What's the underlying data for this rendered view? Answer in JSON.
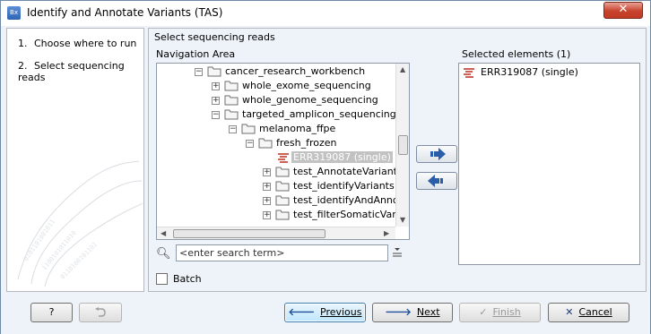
{
  "window": {
    "title": "Identify and Annotate Variants (TAS)",
    "app_icon_text": "Bx",
    "close_glyph": "✕"
  },
  "steps": [
    {
      "number": "1.",
      "label": "Choose where to run"
    },
    {
      "number": "2.",
      "label": "Select sequencing reads"
    }
  ],
  "main": {
    "section_title": "Select sequencing reads",
    "nav_area_label": "Navigation Area",
    "selected_label": "Selected elements (1)"
  },
  "tree": {
    "rows": [
      {
        "label": "cancer_research_workbench",
        "type": "folder",
        "expander": "-"
      },
      {
        "label": "whole_exome_sequencing",
        "type": "folder",
        "expander": "+"
      },
      {
        "label": "whole_genome_sequencing",
        "type": "folder",
        "expander": "+"
      },
      {
        "label": "targeted_amplicon_sequencing",
        "type": "folder",
        "expander": "-"
      },
      {
        "label": "melanoma_ffpe",
        "type": "folder",
        "expander": "-"
      },
      {
        "label": "fresh_frozen",
        "type": "folder",
        "expander": "-"
      },
      {
        "label": "ERR319087 (single)",
        "type": "sequence",
        "expander": "",
        "selected": true
      },
      {
        "label": "test_AnnotateVariants",
        "type": "folder",
        "expander": "+"
      },
      {
        "label": "test_identifyVariants",
        "type": "folder",
        "expander": "+"
      },
      {
        "label": "test_identifyAndAnnota",
        "type": "folder",
        "expander": "+"
      },
      {
        "label": "test_filterSomaticVarian",
        "type": "folder",
        "expander": "+"
      }
    ]
  },
  "search": {
    "placeholder": "<enter search term>",
    "value": "<enter search term>"
  },
  "batch": {
    "label": "Batch",
    "checked": false
  },
  "selected_elements": [
    {
      "label": "ERR319087 (single)"
    }
  ],
  "footer": {
    "help_label": "?",
    "previous_label": "Previous",
    "next_label": "Next",
    "finish_label": "Finish",
    "cancel_label": "Cancel"
  },
  "colors": {
    "accent": "#2b5ea8",
    "sequence_icon": "#c0392b",
    "folder_fill": "#f6f6f6"
  }
}
